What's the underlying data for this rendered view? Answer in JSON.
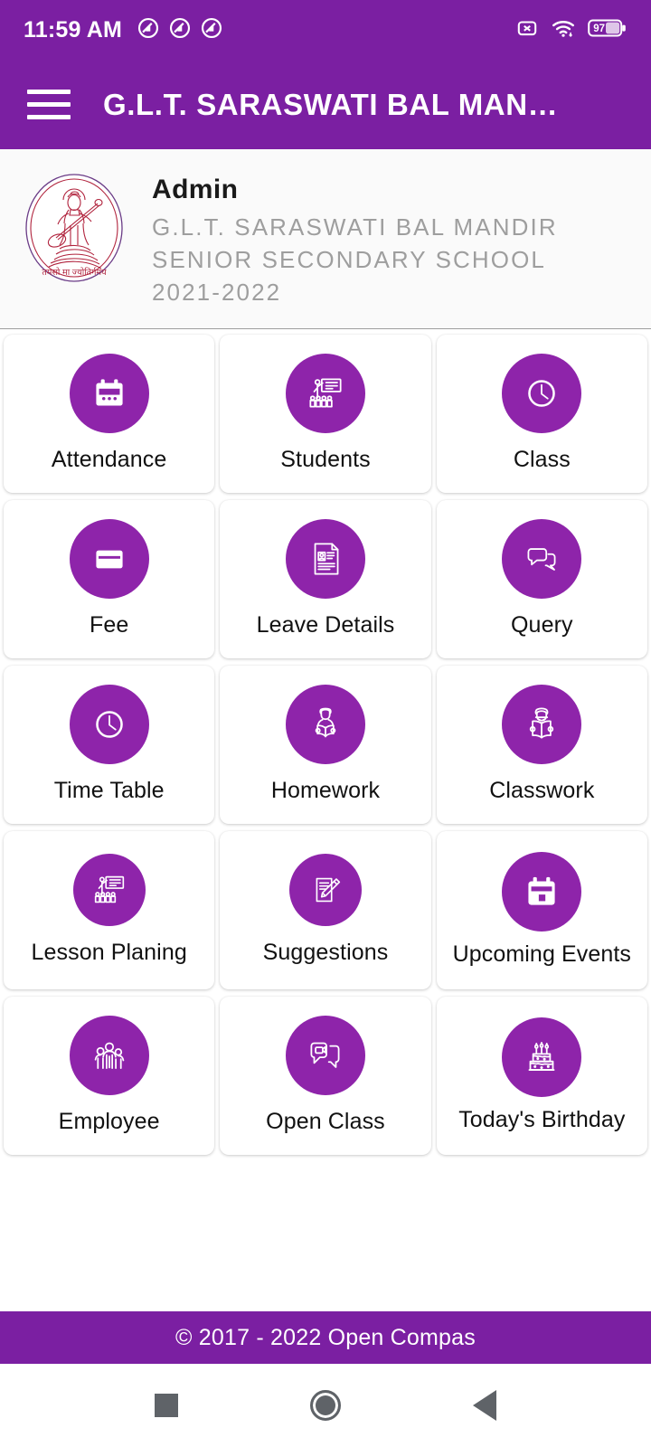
{
  "status_bar": {
    "clock": "11:59 AM",
    "left_icons": [
      "do-not-disturb-icon",
      "do-not-disturb-icon",
      "do-not-disturb-icon"
    ],
    "right_icons": [
      "no-sim-icon",
      "wifi-icon",
      "battery-icon"
    ],
    "battery_level": "97"
  },
  "app_bar": {
    "menu_icon": "hamburger-menu-icon",
    "title": "G.L.T. SARASWATI BAL MAN…"
  },
  "profile": {
    "logo_icon": "school-logo-saraswati",
    "role": "Admin",
    "school_name": "G.L.T. SARASWATI BAL MANDIR SENIOR SECONDARY SCHOOL",
    "session": "2021-2022"
  },
  "menu": {
    "tiles": [
      {
        "label": "Attendance",
        "icon": "calendar-icon",
        "size": "big"
      },
      {
        "label": "Students",
        "icon": "classroom-icon",
        "size": "big"
      },
      {
        "label": "Class",
        "icon": "clock-icon",
        "size": "big"
      },
      {
        "label": "Fee",
        "icon": "payment-card-icon",
        "size": "big"
      },
      {
        "label": "Leave Details",
        "icon": "id-document-icon",
        "size": "big"
      },
      {
        "label": "Query",
        "icon": "chat-bubbles-icon",
        "size": "big"
      },
      {
        "label": "Time Table",
        "icon": "clock-icon",
        "size": "big"
      },
      {
        "label": "Homework",
        "icon": "student-reading-icon",
        "size": "big"
      },
      {
        "label": "Classwork",
        "icon": "open-book-reader-icon",
        "size": "big"
      },
      {
        "label": "Lesson Planing",
        "icon": "classroom-icon",
        "size": "mid"
      },
      {
        "label": "Suggestions",
        "icon": "note-pencil-icon",
        "size": "mid"
      },
      {
        "label": "Upcoming Events",
        "icon": "calendar-event-icon",
        "size": "big"
      },
      {
        "label": "Employee",
        "icon": "people-group-icon",
        "size": "big"
      },
      {
        "label": "Open Class",
        "icon": "video-chat-icon",
        "size": "big"
      },
      {
        "label": "Today's Birthday",
        "icon": "birthday-cake-icon",
        "size": "big"
      }
    ]
  },
  "footer": {
    "copyright": "© 2017 - 2022 Open Compas"
  },
  "nav_bar": {
    "recents_icon": "square-recents-icon",
    "home_icon": "circle-home-icon",
    "back_icon": "triangle-back-icon"
  },
  "colors": {
    "brand_purple": "#7B1FA2",
    "badge_purple": "#8E24AA",
    "logo_crimson": "#B0223C",
    "muted_text": "#9e9e9e"
  }
}
